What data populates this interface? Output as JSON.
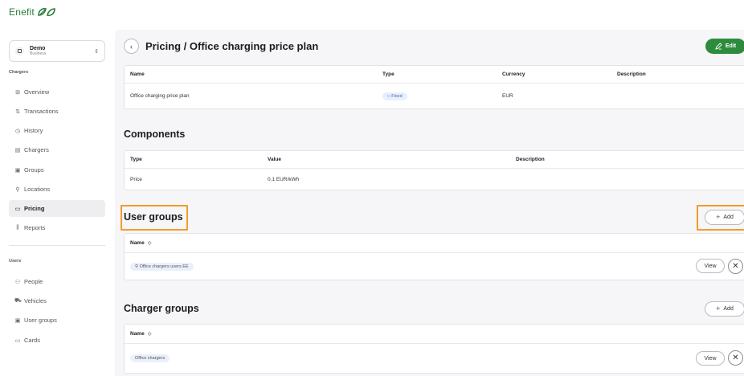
{
  "app": {
    "logo_text": "Enefit"
  },
  "workspace": {
    "name": "Demo",
    "subtitle": "Business"
  },
  "sidebar": {
    "chargers_section": "Chargers",
    "chargers_items": [
      {
        "label": "Overview",
        "icon": "grid-icon"
      },
      {
        "label": "Transactions",
        "icon": "transactions-icon"
      },
      {
        "label": "History",
        "icon": "clock-icon"
      },
      {
        "label": "Chargers",
        "icon": "charger-icon"
      },
      {
        "label": "Groups",
        "icon": "groups-icon"
      },
      {
        "label": "Locations",
        "icon": "location-pin-icon"
      },
      {
        "label": "Pricing",
        "icon": "pricing-icon",
        "active": true
      },
      {
        "label": "Reports",
        "icon": "reports-icon"
      }
    ],
    "users_section": "Users",
    "users_items": [
      {
        "label": "People",
        "icon": "people-icon"
      },
      {
        "label": "Vehicles",
        "icon": "car-icon"
      },
      {
        "label": "User groups",
        "icon": "user-groups-icon"
      },
      {
        "label": "Cards",
        "icon": "card-icon"
      }
    ]
  },
  "header": {
    "title": "Pricing / Office charging price plan",
    "edit_label": "Edit"
  },
  "plan_table": {
    "columns": [
      "Name",
      "Type",
      "Currency",
      "Description"
    ],
    "row": {
      "name": "Office charging price plan",
      "type": "Fixed",
      "currency": "EUR",
      "description": ""
    }
  },
  "components": {
    "title": "Components",
    "columns": [
      "Type",
      "Value",
      "Description"
    ],
    "row": {
      "type": "Price",
      "value": "0.1 EUR/kWh",
      "description": ""
    }
  },
  "user_groups": {
    "title": "User groups",
    "add_label": "Add",
    "column": "Name",
    "rows": [
      {
        "name": "Office chargers users EE",
        "view_label": "View"
      }
    ]
  },
  "charger_groups": {
    "title": "Charger groups",
    "add_label": "Add",
    "column": "Name",
    "rows": [
      {
        "name": "Office chargers",
        "view_label": "View"
      }
    ]
  },
  "colors": {
    "brand_green": "#2e8b3e",
    "highlight_orange": "#f39c2b"
  }
}
